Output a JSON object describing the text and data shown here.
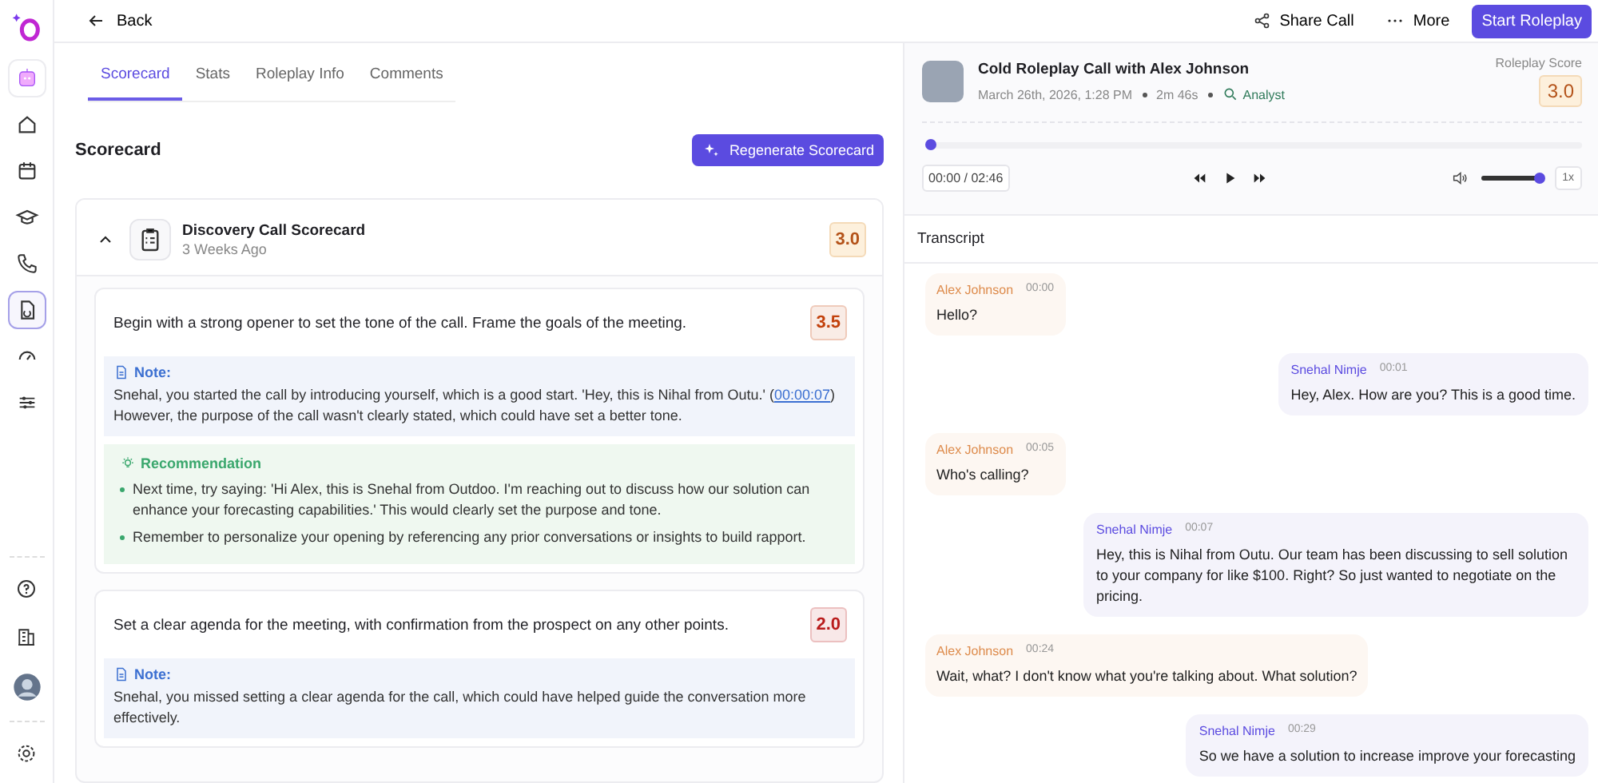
{
  "sidebar": {
    "top_items": [
      {
        "selected": false
      },
      {
        "selected": false
      },
      {
        "selected": false
      },
      {
        "selected": false
      },
      {
        "selected": false
      },
      {
        "selected": true
      },
      {
        "selected": false
      },
      {
        "selected": false
      }
    ]
  },
  "topbar": {
    "back": "Back",
    "share": "Share Call",
    "more": "More",
    "start": "Start Roleplay"
  },
  "tabs": [
    {
      "label": "Scorecard",
      "selected": true
    },
    {
      "label": "Stats",
      "selected": false
    },
    {
      "label": "Roleplay Info",
      "selected": false
    },
    {
      "label": "Comments",
      "selected": false
    }
  ],
  "scorecard": {
    "heading": "Scorecard",
    "regenerate": "Regenerate Scorecard",
    "title": "Discovery Call Scorecard",
    "age": "3 Weeks Ago",
    "score": "3.0",
    "expanded": true,
    "criteria": [
      {
        "text": "Begin with a strong opener to set the tone of the call. Frame the goals of the meeting.",
        "score": "3.5",
        "color": "#c2410c",
        "note_label": "Note:",
        "note_before": "Snehal, you started the call by introducing yourself, which is a good start. 'Hey, this is Nihal from Outu.' (",
        "note_link": "00:00:07",
        "note_after": ") However, the purpose of the call wasn't clearly stated, which could have set a better tone.",
        "rec_label": "Recommendation",
        "recommendations": [
          "Next time, try saying: 'Hi Alex, this is Snehal from Outdoo. I'm reaching out to discuss how our solution can enhance your forecasting capabilities.' This would clearly set the purpose and tone.",
          "Remember to personalize your opening by referencing any prior conversations or insights to build rapport."
        ]
      },
      {
        "text": "Set a clear agenda for the meeting, with confirmation from the prospect on any other points.",
        "score": "2.0",
        "color": "#b91c1c",
        "note_label": "Note:",
        "note_before": "Snehal, you missed setting a clear agenda for the call, which could have helped guide the conversation more effectively."
      }
    ]
  },
  "call": {
    "title": "Cold Roleplay Call with Alex Johnson",
    "date": "March 26th, 2026, 1:28 PM",
    "duration": "2m 46s",
    "persona": "Analyst",
    "score_label": "Roleplay Score",
    "score": "3.0"
  },
  "player": {
    "progress": {
      "level": 0
    },
    "time": "00:00 / 02:46",
    "volume": {
      "level": 0.95
    },
    "speed": "1x"
  },
  "transcript": {
    "heading": "Transcript",
    "messages": [
      {
        "kind": "prospect",
        "speaker": "Alex Johnson",
        "time": "00:00",
        "text": "Hello?"
      },
      {
        "kind": "rep",
        "speaker": "Snehal Nimje",
        "time": "00:01",
        "text": "Hey, Alex. How are you? This is a good time."
      },
      {
        "kind": "prospect",
        "speaker": "Alex Johnson",
        "time": "00:05",
        "text": "Who's calling?"
      },
      {
        "kind": "rep",
        "speaker": "Snehal Nimje",
        "time": "00:07",
        "text": "Hey, this is Nihal from Outu. Our team has been discussing to sell solution to your company for like $100. Right? So just wanted to negotiate on the pricing."
      },
      {
        "kind": "prospect",
        "speaker": "Alex Johnson",
        "time": "00:24",
        "text": "Wait, what? I don't know what you're talking about. What solution?"
      },
      {
        "kind": "rep",
        "speaker": "Snehal Nimje",
        "time": "00:29",
        "text": "So we have a solution to increase improve your forecasting"
      }
    ]
  }
}
